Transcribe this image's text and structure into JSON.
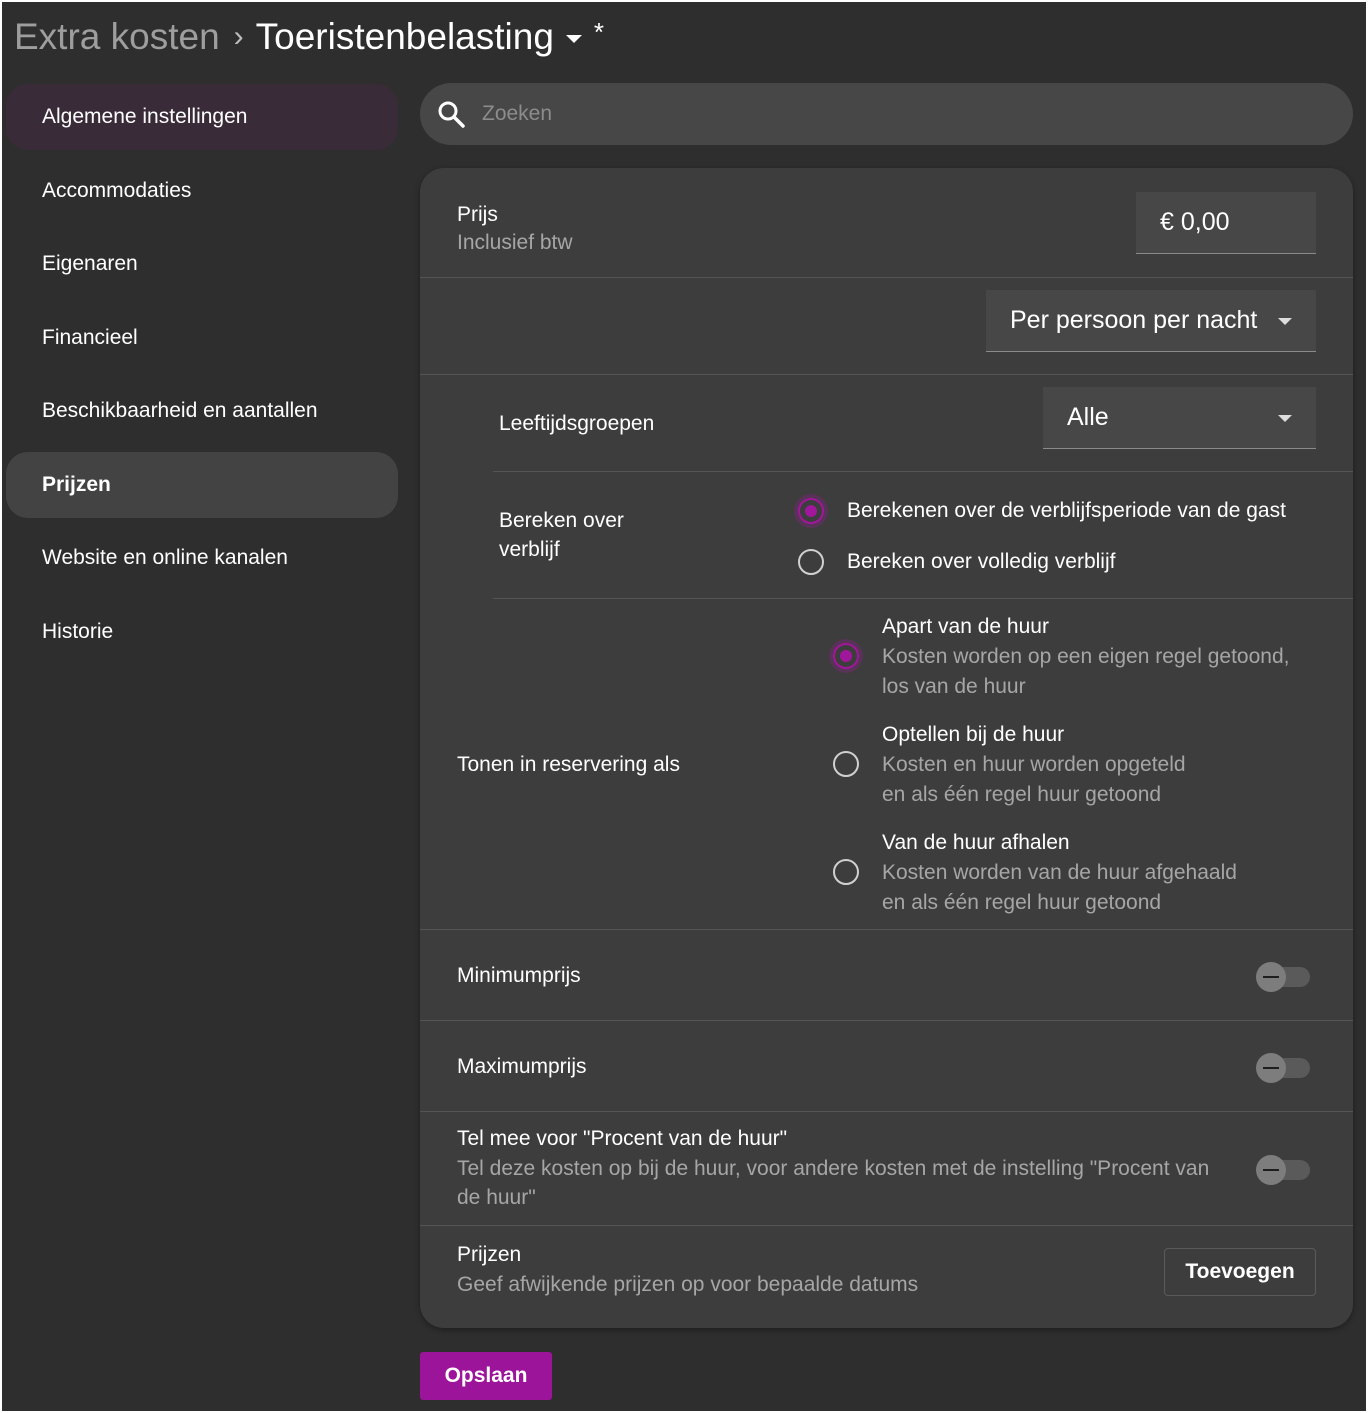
{
  "header": {
    "parent": "Extra kosten",
    "separator": "›",
    "current": "Toeristenbelasting",
    "unsaved_marker": "*"
  },
  "sidebar": {
    "items": [
      {
        "label": "Algemene instellingen"
      },
      {
        "label": "Accommodaties"
      },
      {
        "label": "Eigenaren"
      },
      {
        "label": "Financieel"
      },
      {
        "label": "Beschikbaarheid en aantallen"
      },
      {
        "label": "Prijzen"
      },
      {
        "label": "Website en online kanalen"
      },
      {
        "label": "Historie"
      }
    ]
  },
  "search": {
    "placeholder": "Zoeken"
  },
  "form": {
    "price": {
      "label": "Prijs",
      "sublabel": "Inclusief btw",
      "value": "€ 0,00"
    },
    "unit": {
      "selected": "Per persoon per nacht"
    },
    "age_groups": {
      "label": "Leeftijdsgroepen",
      "selected": "Alle"
    },
    "calc_over_stay": {
      "label_line1": "Bereken over",
      "label_line2": "verblijf",
      "options": [
        {
          "label": "Berekenen over de verblijfsperiode van de gast",
          "checked": true
        },
        {
          "label": "Bereken over volledig verblijf",
          "checked": false
        }
      ]
    },
    "show_in_reservation": {
      "label": "Tonen in reservering als",
      "options": [
        {
          "title": "Apart van de huur",
          "desc1": "Kosten worden op een eigen regel getoond,",
          "desc2": "los van de huur",
          "checked": true
        },
        {
          "title": "Optellen bij de huur",
          "desc1": "Kosten en huur worden opgeteld",
          "desc2": "en als één regel huur getoond",
          "checked": false
        },
        {
          "title": "Van de huur afhalen",
          "desc1": "Kosten worden van de huur afgehaald",
          "desc2": "en als één regel huur getoond",
          "checked": false
        }
      ]
    },
    "min_price": {
      "label": "Minimumprijs",
      "enabled": false
    },
    "max_price": {
      "label": "Maximumprijs",
      "enabled": false
    },
    "percent_of_rent": {
      "label": "Tel mee voor \"Procent van de huur\"",
      "desc1": "Tel deze kosten op bij de huur, voor andere kosten met de instelling \"Procent van",
      "desc2": "de huur\"",
      "enabled": false
    },
    "prices": {
      "label": "Prijzen",
      "sublabel": "Geef afwijkende prijzen op voor bepaalde datums",
      "button": "Toevoegen"
    }
  },
  "actions": {
    "save": "Opslaan"
  },
  "colors": {
    "accent": "#9c149a",
    "background": "#2e2e2e",
    "card": "#3d3d3d"
  }
}
